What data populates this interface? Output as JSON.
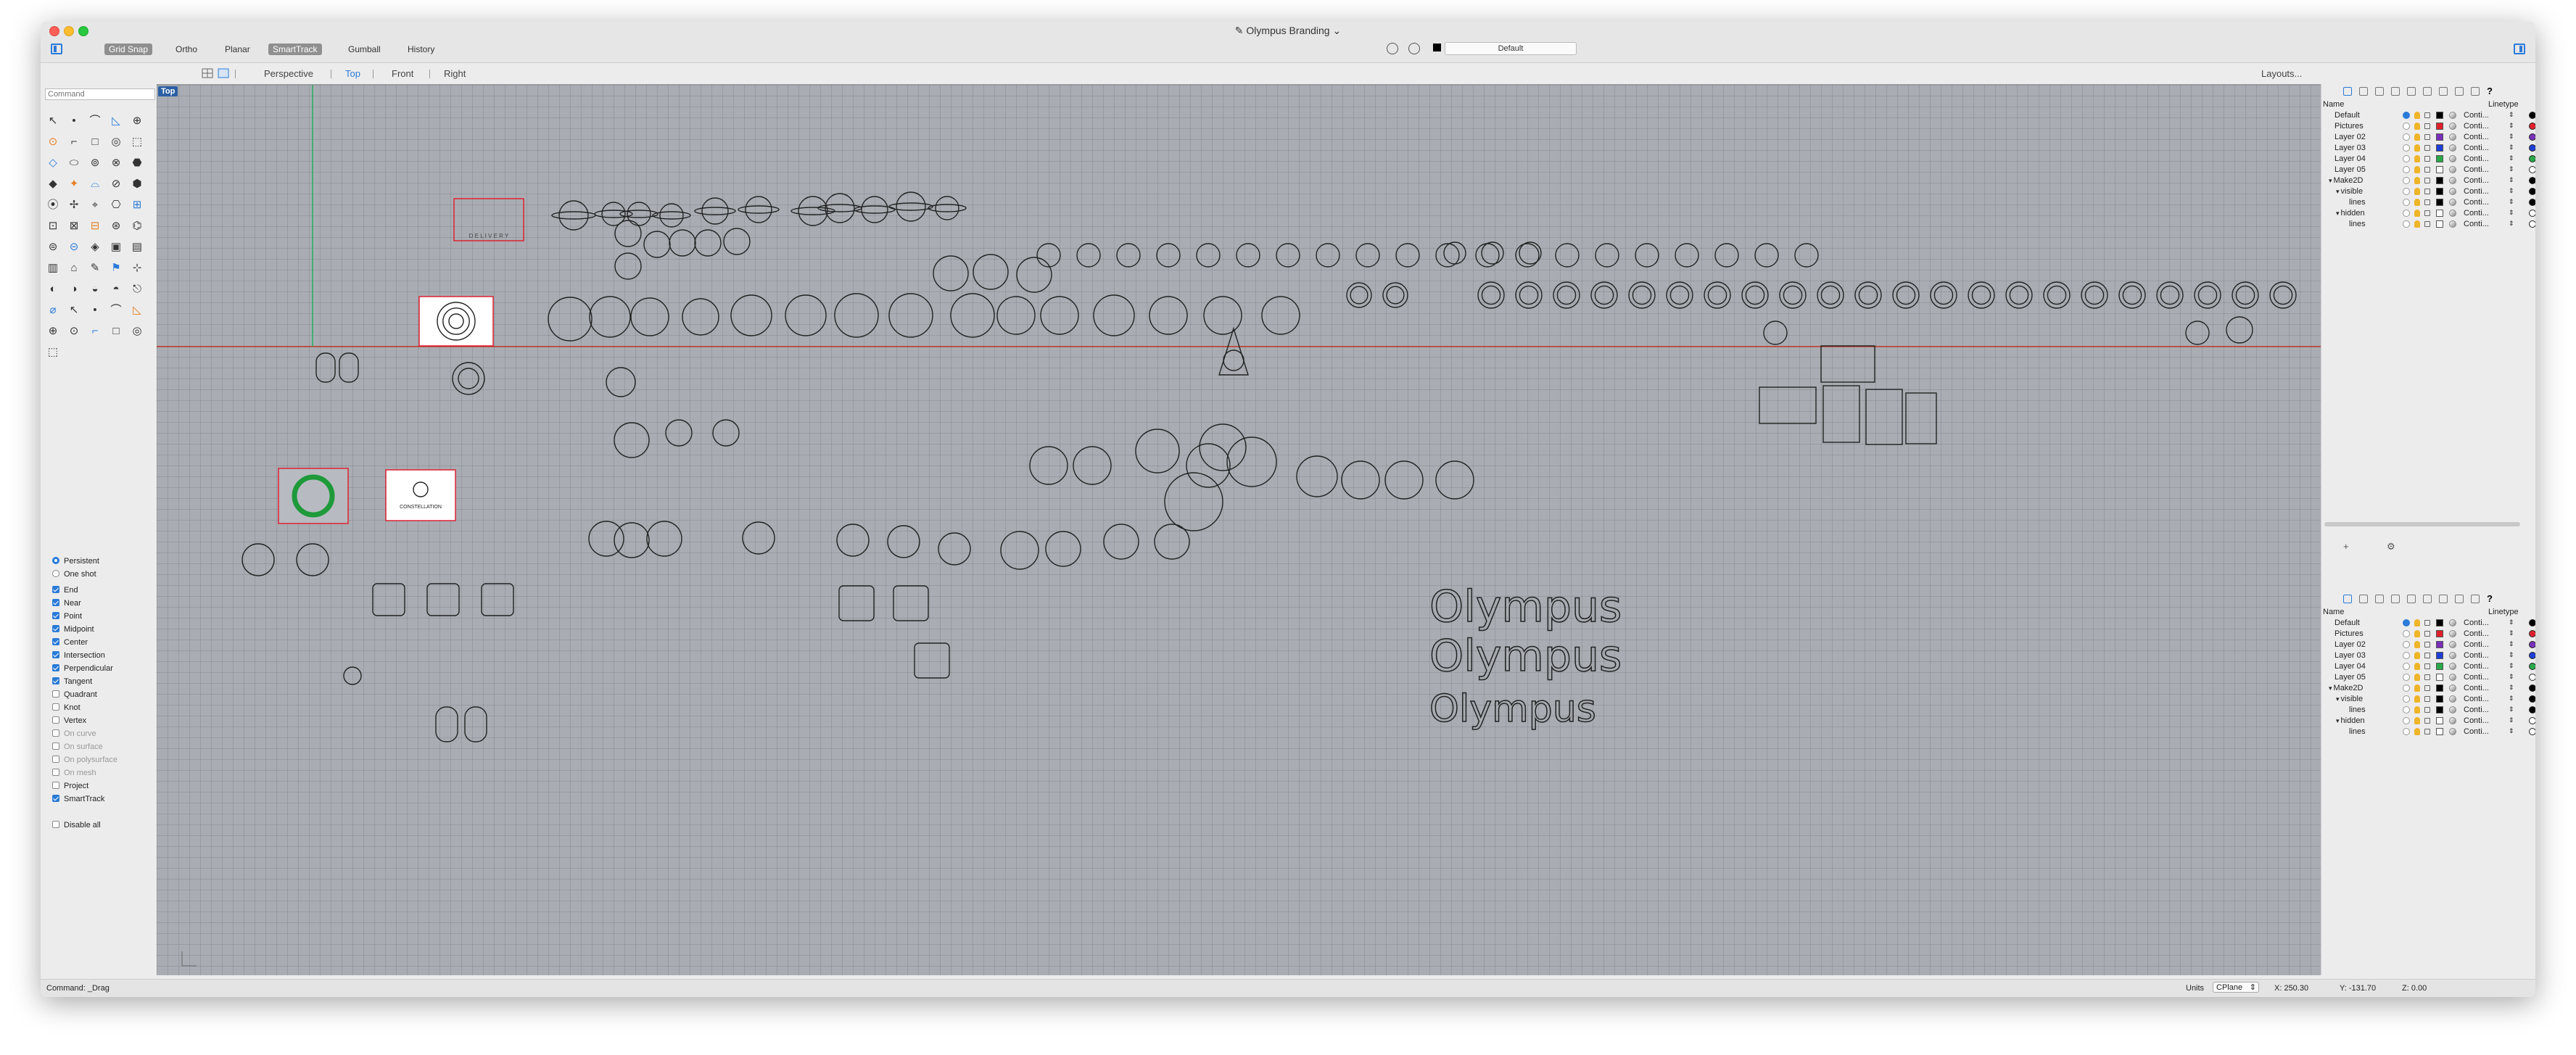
{
  "window": {
    "title": "Olympus Branding"
  },
  "toolbar": {
    "buttons": [
      {
        "label": "Grid Snap",
        "on": true
      },
      {
        "label": "Ortho",
        "on": false
      },
      {
        "label": "Planar",
        "on": false
      },
      {
        "label": "SmartTrack",
        "on": true
      },
      {
        "label": "Gumball",
        "on": false
      },
      {
        "label": "History",
        "on": false
      }
    ],
    "layer_dropdown": "Default"
  },
  "viewport_tabs": [
    "Perspective",
    "Top",
    "Front",
    "Right"
  ],
  "active_tab": "Top",
  "layouts_label": "Layouts...",
  "viewport_label": "Top",
  "command": {
    "placeholder": "Command"
  },
  "osnap": {
    "mode_options": [
      {
        "label": "Persistent",
        "selected": true
      },
      {
        "label": "One shot",
        "selected": false
      }
    ],
    "items": [
      {
        "label": "End",
        "checked": true,
        "enabled": true
      },
      {
        "label": "Near",
        "checked": true,
        "enabled": true
      },
      {
        "label": "Point",
        "checked": true,
        "enabled": true
      },
      {
        "label": "Midpoint",
        "checked": true,
        "enabled": true
      },
      {
        "label": "Center",
        "checked": true,
        "enabled": true
      },
      {
        "label": "Intersection",
        "checked": true,
        "enabled": true
      },
      {
        "label": "Perpendicular",
        "checked": true,
        "enabled": true
      },
      {
        "label": "Tangent",
        "checked": true,
        "enabled": true
      },
      {
        "label": "Quadrant",
        "checked": false,
        "enabled": true
      },
      {
        "label": "Knot",
        "checked": false,
        "enabled": true
      },
      {
        "label": "Vertex",
        "checked": false,
        "enabled": true
      },
      {
        "label": "On curve",
        "checked": false,
        "enabled": false
      },
      {
        "label": "On surface",
        "checked": false,
        "enabled": false
      },
      {
        "label": "On polysurface",
        "checked": false,
        "enabled": false
      },
      {
        "label": "On mesh",
        "checked": false,
        "enabled": false
      },
      {
        "label": "Project",
        "checked": false,
        "enabled": true
      },
      {
        "label": "SmartTrack",
        "checked": true,
        "enabled": true
      }
    ],
    "disable_all": "Disable all"
  },
  "layers_panel": {
    "header_name": "Name",
    "header_linetype": "Linetype",
    "rows": [
      {
        "name": "Default",
        "indent": 0,
        "color": "#000000",
        "current": true,
        "linetype": "Conti...",
        "plot": "#000000"
      },
      {
        "name": "Pictures",
        "indent": 0,
        "color": "#e0202a",
        "current": false,
        "linetype": "Conti...",
        "plot": "#e0202a"
      },
      {
        "name": "Layer 02",
        "indent": 0,
        "color": "#7a2fb8",
        "current": false,
        "linetype": "Conti...",
        "plot": "#7a2fb8"
      },
      {
        "name": "Layer 03",
        "indent": 0,
        "color": "#1e3fd6",
        "current": false,
        "linetype": "Conti...",
        "plot": "#1e3fd6"
      },
      {
        "name": "Layer 04",
        "indent": 0,
        "color": "#2aa84a",
        "current": false,
        "linetype": "Conti...",
        "plot": "#2aa84a"
      },
      {
        "name": "Layer 05",
        "indent": 0,
        "color": "#ffffff",
        "current": false,
        "linetype": "Conti...",
        "plot": "#ffffff"
      },
      {
        "name": "Make2D",
        "indent": 0,
        "expander": true,
        "color": "#000000",
        "current": false,
        "linetype": "Conti...",
        "plot": "#000000"
      },
      {
        "name": "visible",
        "indent": 1,
        "expander": true,
        "color": "#000000",
        "current": false,
        "linetype": "Conti...",
        "plot": "#000000"
      },
      {
        "name": "lines",
        "indent": 2,
        "color": "#000000",
        "current": false,
        "linetype": "Conti...",
        "plot": "#000000"
      },
      {
        "name": "hidden",
        "indent": 1,
        "expander": true,
        "color": "#ffffff",
        "current": false,
        "linetype": "Conti...",
        "plot": "#ffffff"
      },
      {
        "name": "lines",
        "indent": 2,
        "color": "#ffffff",
        "current": false,
        "linetype": "Conti...",
        "plot": "#ffffff"
      }
    ],
    "add_label": "+",
    "gear_label": "⚙"
  },
  "status": {
    "command": "Command: _Drag",
    "units_label": "Units",
    "cplane": "CPlane",
    "x": "X: 250.30",
    "y": "Y: -131.70",
    "z": "Z: 0.00"
  },
  "drawing_text": {
    "word": "Olympus",
    "logo_caption": "CONSTELLATION",
    "delivery": "D E L I V E R Y"
  },
  "colors": {
    "viewport_bg": "#a9adb3",
    "accent": "#2b7bd8",
    "x_axis": "#c0392b",
    "y_axis": "#27ae60"
  },
  "icons": [
    "sidebar-toggle-icon",
    "gear-icon",
    "plus-icon",
    "lightbulb-icon",
    "lock-icon",
    "material-icon"
  ]
}
